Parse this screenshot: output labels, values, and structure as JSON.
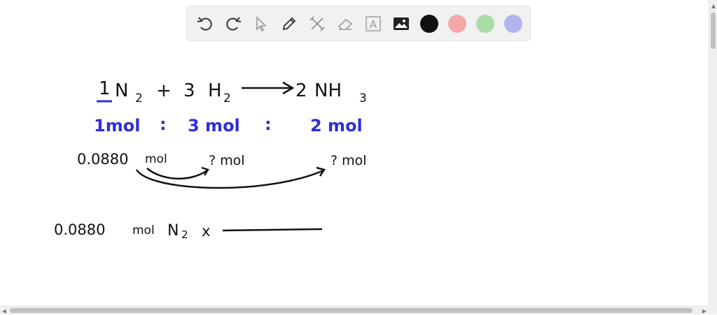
{
  "toolbar": {
    "tools": [
      {
        "name": "undo-icon"
      },
      {
        "name": "redo-icon"
      },
      {
        "name": "pointer-icon"
      },
      {
        "name": "pen-icon"
      },
      {
        "name": "tools-icon"
      },
      {
        "name": "eraser-icon"
      },
      {
        "name": "text-icon"
      },
      {
        "name": "image-icon"
      }
    ],
    "colors": [
      "#111111",
      "#f2a7aa",
      "#a9dca7",
      "#b3b3ee"
    ],
    "text_tool_label": "A"
  },
  "board": {
    "eq": {
      "coef1": "1",
      "n": "N",
      "n_sub": "2",
      "plus": "+",
      "coef3": "3",
      "h": "H",
      "h_sub": "2",
      "coef2": "2",
      "nh": "NH",
      "nh_sub": "3"
    },
    "ratio": {
      "a": "1mol",
      "colon1": ":",
      "b": "3 mol",
      "colon2": ":",
      "c": "2  mol"
    },
    "given": "0.0880",
    "given_unit": "mol",
    "q1": "? mol",
    "q2": "? mol",
    "calc_value": "0.0880",
    "calc_unit": "mol",
    "calc_species": "N",
    "calc_sub": "2",
    "calc_times": "x"
  },
  "colors": {
    "ink": "#111111",
    "blue": "#2f2fd2"
  }
}
